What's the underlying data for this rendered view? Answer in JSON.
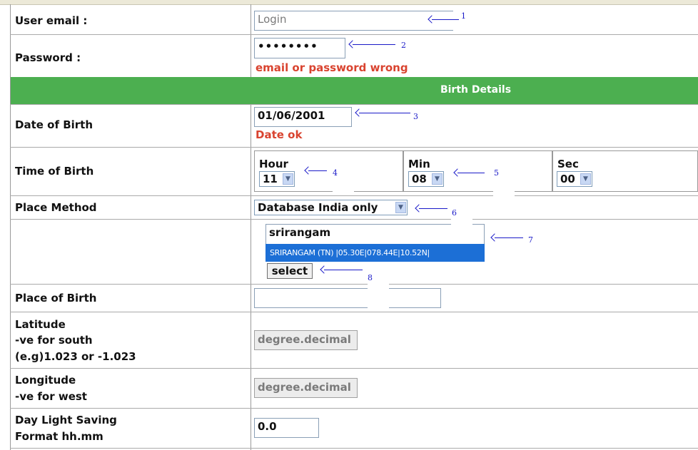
{
  "form": {
    "labels": {
      "user_email": "User email :",
      "password": "Password :",
      "date_of_birth": "Date of Birth",
      "time_of_birth": "Time of Birth",
      "place_method": "Place Method",
      "place_of_birth": "Place of Birth",
      "latitude_1": "Latitude",
      "latitude_2": "-ve for south",
      "latitude_3": "(e.g)1.023 or -1.023",
      "longitude_1": "Longitude",
      "longitude_2": "-ve for west",
      "dst_1": "Day Light Saving",
      "dst_2": "Format hh.mm"
    },
    "section_header": "Birth Details",
    "email_placeholder": "Login",
    "password_value": "••••••••",
    "password_error": "email or password wrong",
    "dob_value": "01/06/2001",
    "dob_status": "Date ok",
    "time": {
      "hour_label": "Hour",
      "hour_value": "11",
      "min_label": "Min",
      "min_value": "08",
      "sec_label": "Sec",
      "sec_value": "00"
    },
    "place_method_value": "Database India only",
    "place_search_value": "srirangam",
    "suggestion": "SRIRANGAM (TN) |05.30E|078.44E|10.52N|",
    "select_button": "select",
    "place_of_birth_value": "",
    "latitude_placeholder": "degree.decimal",
    "longitude_placeholder": "degree.decimal",
    "dst_value": "0.0"
  },
  "annotations": [
    "1",
    "2",
    "3",
    "4",
    "5",
    "6",
    "7",
    "8"
  ],
  "colors": {
    "header_green": "#4caf50",
    "error_red": "#d9432f",
    "annotation_blue": "#1a1ac8",
    "suggestion_blue": "#1c6fd6"
  }
}
